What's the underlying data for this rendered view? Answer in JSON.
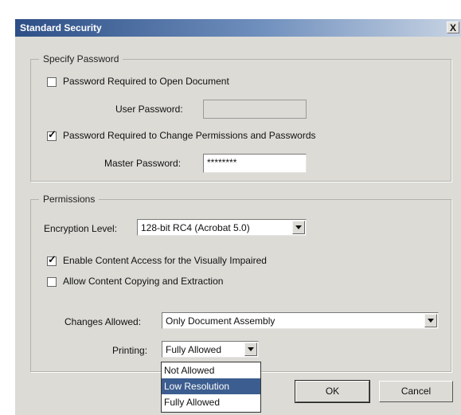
{
  "dialog": {
    "title": "Standard Security",
    "close": "X"
  },
  "specify_password": {
    "legend": "Specify Password",
    "require_open": {
      "label": "Password Required to Open Document",
      "checked": false
    },
    "user_password": {
      "label": "User Password:",
      "value": ""
    },
    "require_permissions": {
      "label": "Password Required to Change Permissions and Passwords",
      "checked": true
    },
    "master_password": {
      "label": "Master Password:",
      "value": "********"
    }
  },
  "permissions": {
    "legend": "Permissions",
    "encryption": {
      "label": "Encryption Level:",
      "value": "128-bit RC4 (Acrobat 5.0)"
    },
    "visually_impaired": {
      "label": "Enable Content Access for the Visually Impaired",
      "checked": true
    },
    "copying": {
      "label": "Allow Content Copying and Extraction",
      "checked": false
    },
    "changes_allowed": {
      "label": "Changes Allowed:",
      "value": "Only Document Assembly"
    },
    "printing": {
      "label": "Printing:",
      "value": "Fully Allowed",
      "options": [
        "Not Allowed",
        "Low Resolution",
        "Fully Allowed"
      ],
      "highlighted": "Low Resolution"
    }
  },
  "buttons": {
    "ok": "OK",
    "cancel": "Cancel"
  }
}
